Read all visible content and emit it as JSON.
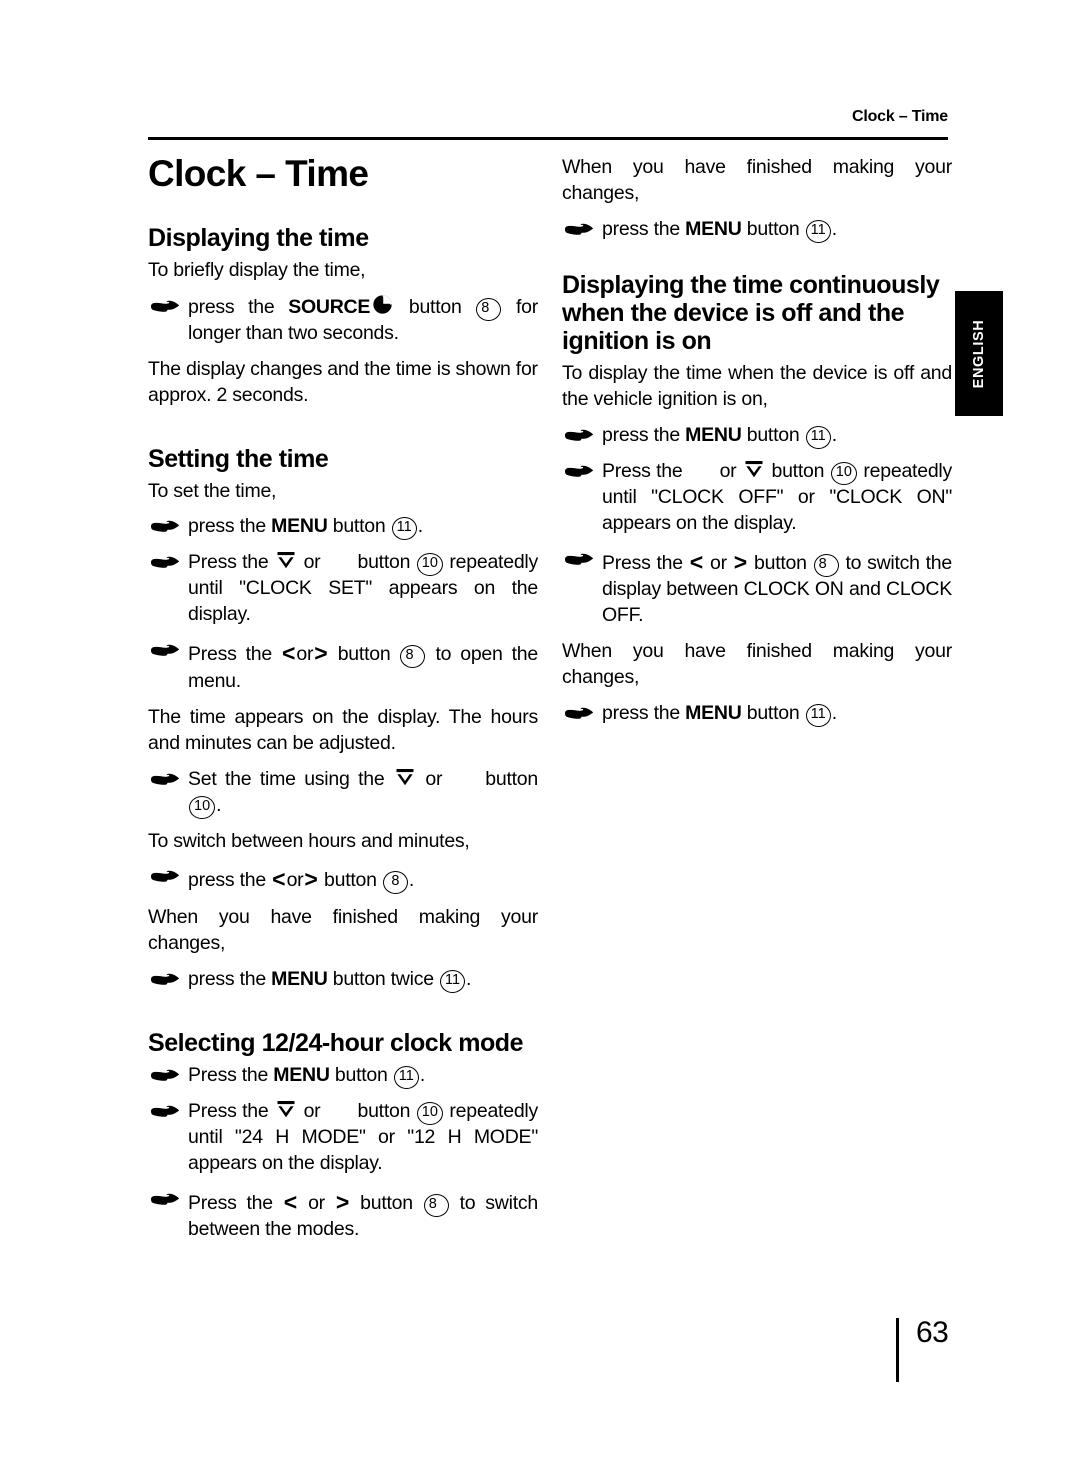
{
  "header": {
    "running_head": "Clock – Time"
  },
  "language_tab": {
    "label": "ENGLISH"
  },
  "folio": {
    "page_number": "63"
  },
  "icons": {
    "hand_bullet": "pointing-hand-icon",
    "clock": "clock-icon",
    "up_arrow_bar": "up-arrow-with-bar-icon",
    "left_chevron": "left-chevron-icon",
    "right_chevron": "right-chevron-icon"
  },
  "left_column": {
    "chapter_title": "Clock – Time",
    "sections": [
      {
        "title": "Displaying the time",
        "blocks": [
          {
            "kind": "para",
            "text": "To briefly display the time,"
          },
          {
            "kind": "step",
            "lead": "press the ",
            "bold": "SOURCE",
            "icon": "clock",
            "mid": " button ",
            "ref": "8",
            "tail": " for longer than two seconds."
          },
          {
            "kind": "para",
            "text": "The display changes and the time is shown for approx. 2 seconds."
          }
        ]
      },
      {
        "title": "Setting the time",
        "blocks": [
          {
            "kind": "para",
            "text": "To set the time,"
          },
          {
            "kind": "step",
            "lead": "press the ",
            "bold": "MENU",
            "mid": " button ",
            "ref": "11",
            "tail": "."
          },
          {
            "kind": "step",
            "lead": "Press the ",
            "icon": "up_arrow_bar",
            "mid2": " or ",
            "blank": true,
            "mid": " button ",
            "ref": "10",
            "tail": " repeatedly until \"CLOCK SET\" appears on the display."
          },
          {
            "kind": "step",
            "lead": "Press the ",
            "chev_pair": true,
            "mid": " button ",
            "ref": "8",
            "tail": " to open the menu."
          },
          {
            "kind": "para",
            "text": "The time appears on the display. The hours and minutes can be adjusted."
          },
          {
            "kind": "step",
            "lead": "Set the time using the ",
            "icon": "up_arrow_bar",
            "mid2": " or ",
            "blank": true,
            "mid": " button ",
            "ref": "10",
            "tail": "."
          },
          {
            "kind": "para",
            "text": "To switch between hours and minutes,"
          },
          {
            "kind": "step",
            "lead": "press the ",
            "chev_pair": true,
            "mid": " button ",
            "ref": "8",
            "tail": "."
          },
          {
            "kind": "para",
            "text": "When you have finished making your changes,"
          },
          {
            "kind": "step",
            "lead": "press the ",
            "bold": "MENU",
            "mid": " button twice ",
            "ref": "11",
            "tail": "."
          }
        ]
      },
      {
        "title": "Selecting 12/24-hour clock mode",
        "blocks": [
          {
            "kind": "step",
            "lead": "Press the ",
            "bold": "MENU",
            "mid": " button ",
            "ref": "11",
            "tail": "."
          },
          {
            "kind": "step",
            "lead": "Press the ",
            "icon": "up_arrow_bar",
            "mid2": " or ",
            "blank": true,
            "mid": " button ",
            "ref": "10",
            "tail": " repeatedly until \"24 H MODE\" or \"12 H MODE\" appears on the display."
          },
          {
            "kind": "step",
            "lead": "Press the ",
            "chev_pair": true,
            "mid": " button ",
            "ref": "8",
            "tail": " to switch between the modes."
          }
        ]
      }
    ]
  },
  "right_column": {
    "intro": [
      {
        "kind": "para",
        "text": "When you have finished making your changes,"
      },
      {
        "kind": "step",
        "lead": "press the ",
        "bold": "MENU",
        "mid": " button ",
        "ref": "11",
        "tail": "."
      }
    ],
    "sections": [
      {
        "title": "Displaying the time continuously when the device is off and the ignition is on",
        "blocks": [
          {
            "kind": "para",
            "text": "To display the time when the device is off and the vehicle ignition is on,"
          },
          {
            "kind": "step",
            "lead": "press the ",
            "bold": "MENU",
            "mid": " button ",
            "ref": "11",
            "tail": "."
          },
          {
            "kind": "step",
            "lead": "Press the ",
            "blank_first": true,
            "mid2": " or ",
            "icon": "up_arrow_bar",
            "mid": " button ",
            "ref": "10",
            "tail": " repeatedly until \"CLOCK OFF\" or \"CLOCK ON\" appears on the display."
          },
          {
            "kind": "step",
            "lead": "Press the ",
            "chev_pair": true,
            "mid": " button ",
            "ref": "8",
            "tail": " to switch the display between CLOCK ON and CLOCK OFF."
          },
          {
            "kind": "para",
            "text": "When you have finished making your changes,"
          },
          {
            "kind": "step",
            "lead": "press the ",
            "bold": "MENU",
            "mid": " button ",
            "ref": "11",
            "tail": "."
          }
        ]
      }
    ]
  }
}
